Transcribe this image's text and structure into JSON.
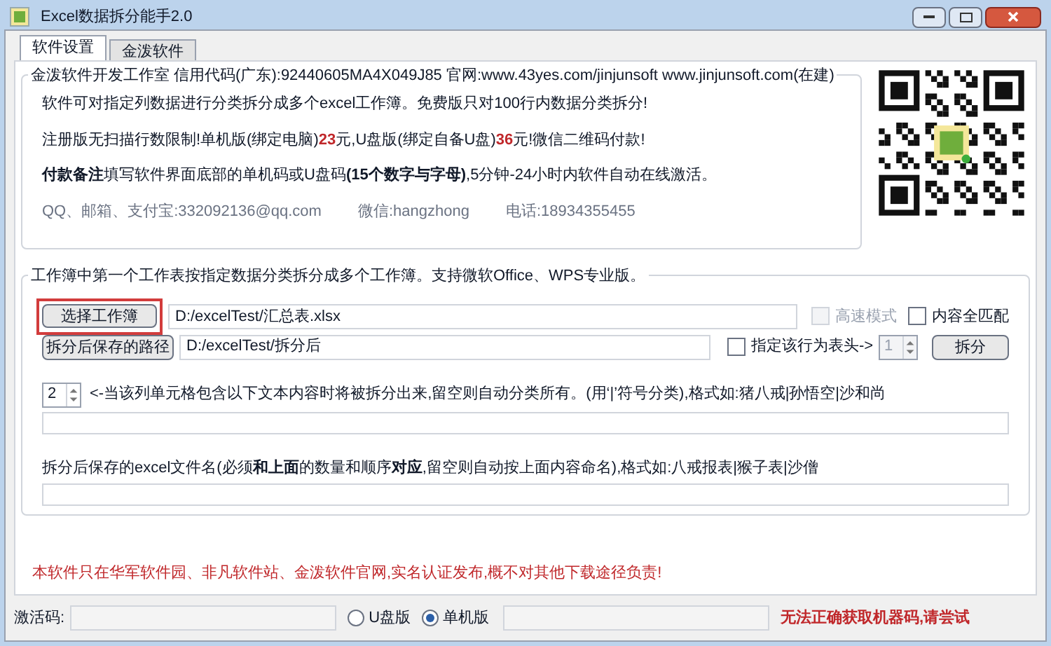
{
  "window": {
    "title": "Excel数据拆分能手2.0"
  },
  "tabs": [
    {
      "label": "软件设置",
      "selected": true
    },
    {
      "label": "金泼软件",
      "selected": false
    }
  ],
  "info_group": {
    "legend": "金泼软件开发工作室 信用代码(广东):92440605MA4X049J85 官网:www.43yes.com/jinjunsoft  www.jinjunsoft.com(在建)",
    "lines": [
      [
        {
          "kind": "plain",
          "text": "软件可对指定列数据进行分类拆分成多个excel工作簿。免费版只对100行内数据分类拆分!"
        }
      ],
      [
        {
          "kind": "plain",
          "text": "注册版无扫描行数限制!单机版(绑定电脑)"
        },
        {
          "kind": "price",
          "text": "23"
        },
        {
          "kind": "plain",
          "text": "元,U盘版(绑定自备U盘)"
        },
        {
          "kind": "price",
          "text": "36"
        },
        {
          "kind": "plain",
          "text": "元!微信二维码付款!"
        }
      ],
      [
        {
          "kind": "bold",
          "text": "付款备注"
        },
        {
          "kind": "plain",
          "text": "填写软件界面底部的单机码或U盘码"
        },
        {
          "kind": "bold",
          "text": "(15个数字与字母)"
        },
        {
          "kind": "plain",
          "text": ",5分钟-24小时内软件自动在线激活。"
        }
      ]
    ],
    "contacts": [
      "QQ、邮箱、支付宝:332092136@qq.com",
      "微信:hangzhong",
      "电话:18934355455"
    ]
  },
  "split_group": {
    "legend": "工作簿中第一个工作表按指定数据分类拆分成多个工作簿。支持微软Office、WPS专业版。",
    "select_button": {
      "label": "选择工作簿",
      "highlighted": true
    },
    "source_path": "D:/excelTest/汇总表.xlsx",
    "fast_mode": {
      "label": "高速模式",
      "checked": false,
      "disabled": true
    },
    "exact_match": {
      "label": "内容全匹配",
      "checked": false
    },
    "save_button": {
      "label": "拆分后保存的路径"
    },
    "save_path": "D:/excelTest/拆分后",
    "header_row": {
      "label": "指定该行为表头->",
      "checked": false
    },
    "header_row_value": "1",
    "split_button": {
      "label": "拆分"
    },
    "column_value": "2",
    "column_hint": "<-当该列单元格包含以下文本内容时将被拆分出来,留空则自动分类所有。(用‘|’符号分类),格式如:猪八戒|孙悟空|沙和尚",
    "filename_hint": "拆分后保存的excel文件名(必须**和上面**的数量和顺序**对应**,留空则自动按上面内容命名),格式如:八戒报表|猴子表|沙僧"
  },
  "notice": "本软件只在华军软件园、非凡软件站、金泼软件官网,实名认证发布,概不对其他下载途径负责!",
  "activation": {
    "label": "激活码:",
    "options": [
      {
        "label": "U盘版",
        "selected": false
      },
      {
        "label": "单机版",
        "selected": true
      }
    ],
    "warning": "无法正确获取机器码,请尝试"
  }
}
